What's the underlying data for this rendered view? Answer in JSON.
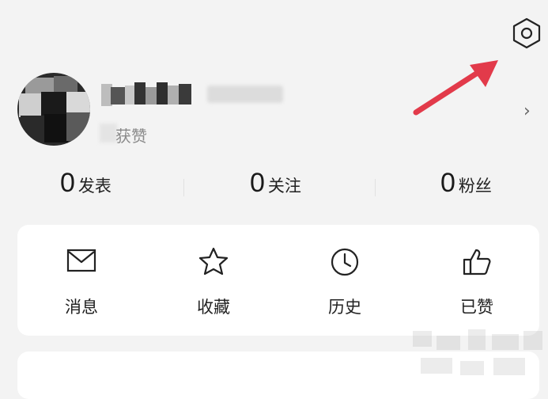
{
  "header": {
    "settings_icon": "settings-icon",
    "annotation_icon": "red-arrow-icon"
  },
  "profile": {
    "likes_label": "获赞",
    "chevron": "›"
  },
  "stats": [
    {
      "count": "0",
      "label": "发表"
    },
    {
      "count": "0",
      "label": "关注"
    },
    {
      "count": "0",
      "label": "粉丝"
    }
  ],
  "actions": [
    {
      "icon": "mail-icon",
      "label": "消息"
    },
    {
      "icon": "star-icon",
      "label": "收藏"
    },
    {
      "icon": "clock-icon",
      "label": "历史"
    },
    {
      "icon": "thumbs-up-icon",
      "label": "已赞"
    }
  ],
  "colors": {
    "background": "#f3f3f3",
    "card": "#ffffff",
    "arrow": "#e23a4a"
  }
}
